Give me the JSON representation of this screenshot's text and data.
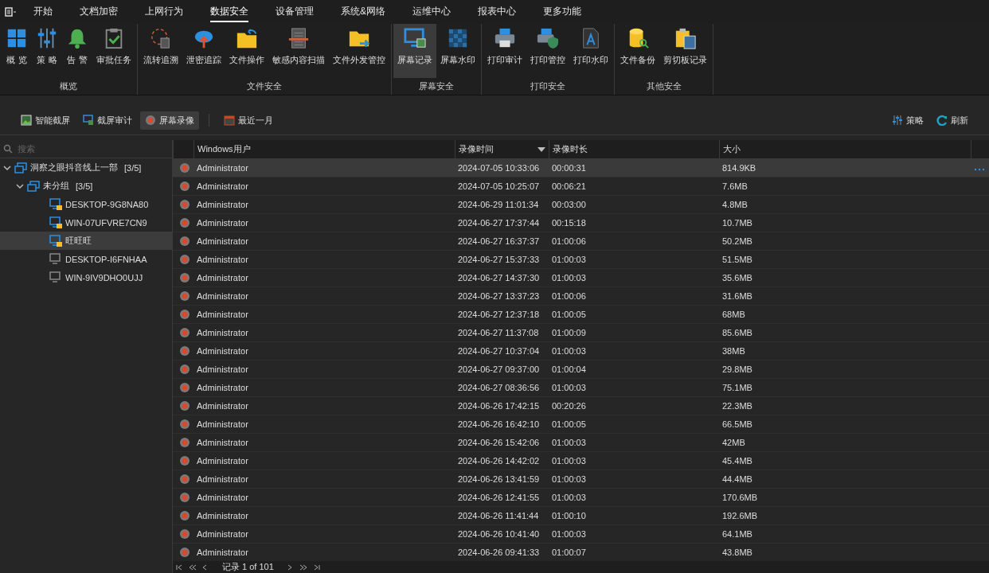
{
  "menu": {
    "tabs": [
      {
        "label": "开始",
        "selected": false
      },
      {
        "label": "文档加密",
        "selected": false
      },
      {
        "label": "上网行为",
        "selected": false
      },
      {
        "label": "数据安全",
        "selected": true
      },
      {
        "label": "设备管理",
        "selected": false
      },
      {
        "label": "系统&网络",
        "selected": false
      },
      {
        "label": "运维中心",
        "selected": false
      },
      {
        "label": "报表中心",
        "selected": false
      },
      {
        "label": "更多功能",
        "selected": false
      }
    ]
  },
  "ribbon": {
    "groups": [
      {
        "label": "概览",
        "items": [
          {
            "label": "概 览",
            "selected": false
          },
          {
            "label": "策 略",
            "selected": false
          },
          {
            "label": "告 警",
            "selected": false
          },
          {
            "label": "审批任务",
            "selected": false
          }
        ]
      },
      {
        "label": "文件安全",
        "items": [
          {
            "label": "流转追溯",
            "selected": false
          },
          {
            "label": "泄密追踪",
            "selected": false
          },
          {
            "label": "文件操作",
            "selected": false
          },
          {
            "label": "敏感内容扫描",
            "selected": false
          },
          {
            "label": "文件外发管控",
            "selected": false
          }
        ]
      },
      {
        "label": "屏幕安全",
        "items": [
          {
            "label": "屏幕记录",
            "selected": true
          },
          {
            "label": "屏幕水印",
            "selected": false
          }
        ]
      },
      {
        "label": "打印安全",
        "items": [
          {
            "label": "打印审计",
            "selected": false
          },
          {
            "label": "打印管控",
            "selected": false
          },
          {
            "label": "打印水印",
            "selected": false
          }
        ]
      },
      {
        "label": "其他安全",
        "items": [
          {
            "label": "文件备份",
            "selected": false
          },
          {
            "label": "剪切板记录",
            "selected": false
          }
        ]
      }
    ]
  },
  "toolbar": {
    "views": [
      {
        "label": "智能截屏",
        "selected": false
      },
      {
        "label": "截屏审计",
        "selected": false
      },
      {
        "label": "屏幕录像",
        "selected": true
      }
    ],
    "period": "最近一月",
    "actions": [
      "策略",
      "刷新"
    ]
  },
  "tree": {
    "search": {
      "placeholder": "搜索"
    },
    "nodes": [
      {
        "label": "洞察之眼抖音线上一部",
        "count": "[3/5]",
        "expanded": true,
        "children": [
          {
            "label": "未分组",
            "count": "[3/5]",
            "expanded": true,
            "children": [
              {
                "label": "DESKTOP-9G8NA80",
                "online": true,
                "selected": false
              },
              {
                "label": "WIN-07UFVRE7CN9",
                "online": true,
                "selected": false
              },
              {
                "label": "旺旺旺",
                "online": true,
                "selected": true
              },
              {
                "label": "DESKTOP-I6FNHAA",
                "online": false,
                "selected": false
              },
              {
                "label": "WIN-9IV9DHO0UJJ",
                "online": false,
                "selected": false
              }
            ]
          }
        ]
      }
    ]
  },
  "table": {
    "columns": [
      {
        "label": "Windows用户",
        "sorted": false
      },
      {
        "label": "录像时间",
        "sorted": true
      },
      {
        "label": "录像时长",
        "sorted": false
      },
      {
        "label": "大小",
        "sorted": false
      }
    ],
    "rows": [
      {
        "user": "Administrator",
        "time": "2024-07-05 10:33:06",
        "duration": "00:00:31",
        "size": "814.9KB",
        "selected": true
      },
      {
        "user": "Administrator",
        "time": "2024-07-05 10:25:07",
        "duration": "00:06:21",
        "size": "7.6MB",
        "selected": false
      },
      {
        "user": "Administrator",
        "time": "2024-06-29 11:01:34",
        "duration": "00:03:00",
        "size": "4.8MB",
        "selected": false
      },
      {
        "user": "Administrator",
        "time": "2024-06-27 17:37:44",
        "duration": "00:15:18",
        "size": "10.7MB",
        "selected": false
      },
      {
        "user": "Administrator",
        "time": "2024-06-27 16:37:37",
        "duration": "01:00:06",
        "size": "50.2MB",
        "selected": false
      },
      {
        "user": "Administrator",
        "time": "2024-06-27 15:37:33",
        "duration": "01:00:03",
        "size": "51.5MB",
        "selected": false
      },
      {
        "user": "Administrator",
        "time": "2024-06-27 14:37:30",
        "duration": "01:00:03",
        "size": "35.6MB",
        "selected": false
      },
      {
        "user": "Administrator",
        "time": "2024-06-27 13:37:23",
        "duration": "01:00:06",
        "size": "31.6MB",
        "selected": false
      },
      {
        "user": "Administrator",
        "time": "2024-06-27 12:37:18",
        "duration": "01:00:05",
        "size": "68MB",
        "selected": false
      },
      {
        "user": "Administrator",
        "time": "2024-06-27 11:37:08",
        "duration": "01:00:09",
        "size": "85.6MB",
        "selected": false
      },
      {
        "user": "Administrator",
        "time": "2024-06-27 10:37:04",
        "duration": "01:00:03",
        "size": "38MB",
        "selected": false
      },
      {
        "user": "Administrator",
        "time": "2024-06-27 09:37:00",
        "duration": "01:00:04",
        "size": "29.8MB",
        "selected": false
      },
      {
        "user": "Administrator",
        "time": "2024-06-27 08:36:56",
        "duration": "01:00:03",
        "size": "75.1MB",
        "selected": false
      },
      {
        "user": "Administrator",
        "time": "2024-06-26 17:42:15",
        "duration": "00:20:26",
        "size": "22.3MB",
        "selected": false
      },
      {
        "user": "Administrator",
        "time": "2024-06-26 16:42:10",
        "duration": "01:00:05",
        "size": "66.5MB",
        "selected": false
      },
      {
        "user": "Administrator",
        "time": "2024-06-26 15:42:06",
        "duration": "01:00:03",
        "size": "42MB",
        "selected": false
      },
      {
        "user": "Administrator",
        "time": "2024-06-26 14:42:02",
        "duration": "01:00:03",
        "size": "45.4MB",
        "selected": false
      },
      {
        "user": "Administrator",
        "time": "2024-06-26 13:41:59",
        "duration": "01:00:03",
        "size": "44.4MB",
        "selected": false
      },
      {
        "user": "Administrator",
        "time": "2024-06-26 12:41:55",
        "duration": "01:00:03",
        "size": "170.6MB",
        "selected": false
      },
      {
        "user": "Administrator",
        "time": "2024-06-26 11:41:44",
        "duration": "01:00:10",
        "size": "192.6MB",
        "selected": false
      },
      {
        "user": "Administrator",
        "time": "2024-06-26 10:41:40",
        "duration": "01:00:03",
        "size": "64.1MB",
        "selected": false
      },
      {
        "user": "Administrator",
        "time": "2024-06-26 09:41:33",
        "duration": "01:00:07",
        "size": "43.8MB",
        "selected": false
      }
    ]
  },
  "pager": {
    "label": "记录 1 of 101"
  }
}
